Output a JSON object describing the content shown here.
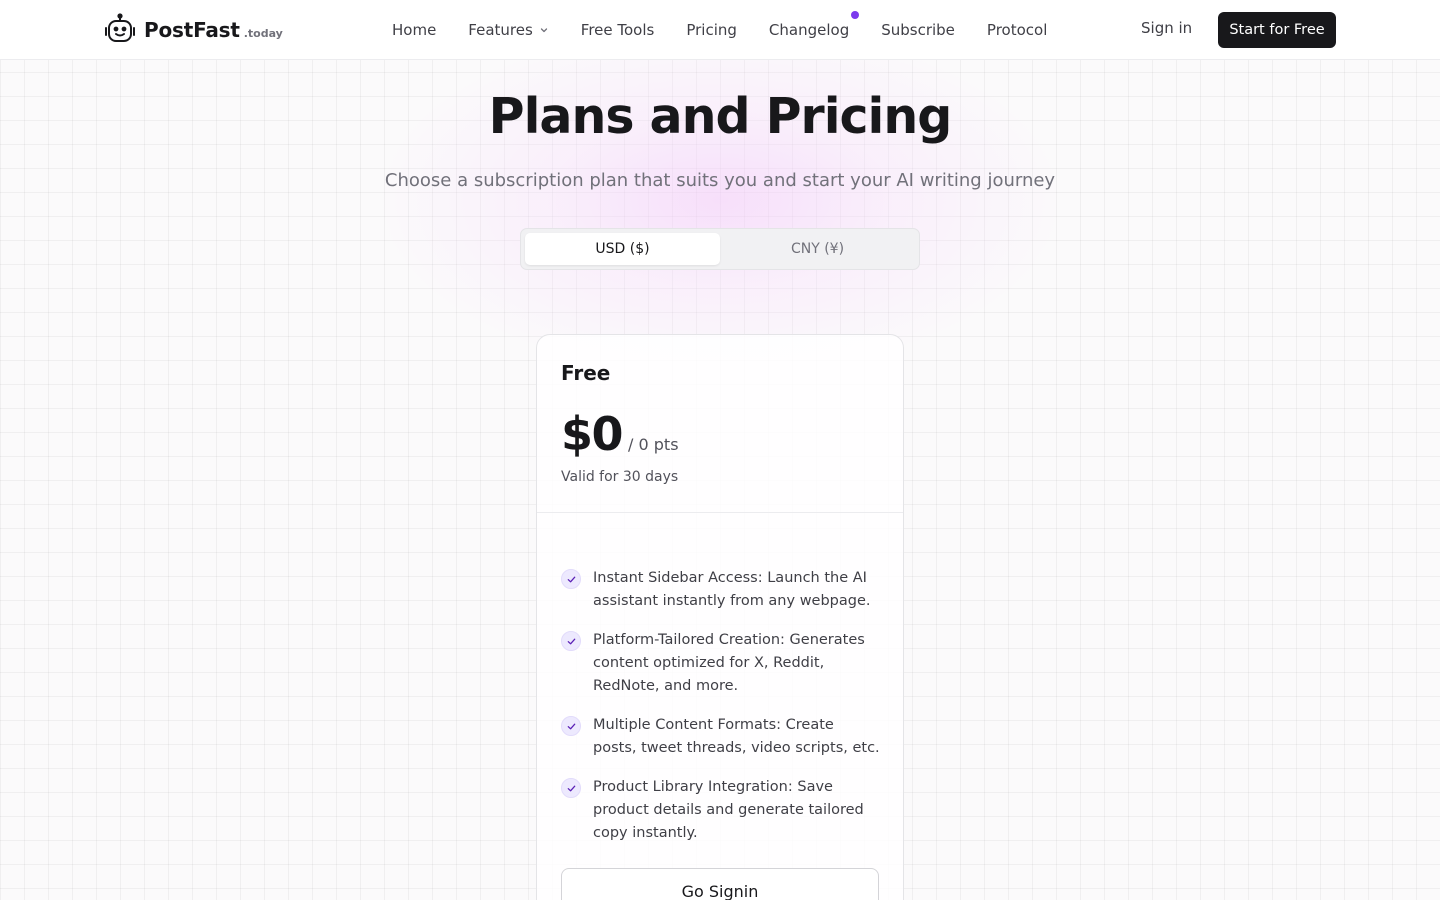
{
  "brand": {
    "name": "PostFast",
    "tld": ".today",
    "icon": "robot-logo-icon"
  },
  "nav": {
    "items": [
      {
        "label": "Home"
      },
      {
        "label": "Features",
        "icon": "chevron-down-icon"
      },
      {
        "label": "Free Tools"
      },
      {
        "label": "Pricing"
      },
      {
        "label": "Changelog",
        "badge": "new-dot"
      },
      {
        "label": "Subscribe"
      },
      {
        "label": "Protocol"
      }
    ],
    "sign_in": "Sign in",
    "cta": "Start for Free"
  },
  "hero": {
    "title": "Plans and Pricing",
    "subtitle": "Choose a subscription plan that suits you and start your AI writing journey"
  },
  "currency_toggle": {
    "options": [
      "USD ($)",
      "CNY (¥)"
    ],
    "selected": "USD ($)"
  },
  "plan": {
    "name": "Free",
    "price": "$0",
    "price_unit": "/ 0 pts",
    "validity": "Valid for 30 days",
    "features": [
      "Instant Sidebar Access: Launch the AI assistant instantly from any webpage.",
      "Platform-Tailored Creation: Generates content optimized for X, Reddit, RedNote, and more.",
      "Multiple Content Formats: Create posts, tweet threads, video scripts, etc.",
      "Product Library Integration: Save product details and generate tailored copy instantly."
    ],
    "button": "Go Signin"
  },
  "colors": {
    "accent": "#7c3aed",
    "cta_bg": "#18181b",
    "check_bg": "#ede9fe",
    "glow": "#f3c8fa"
  }
}
